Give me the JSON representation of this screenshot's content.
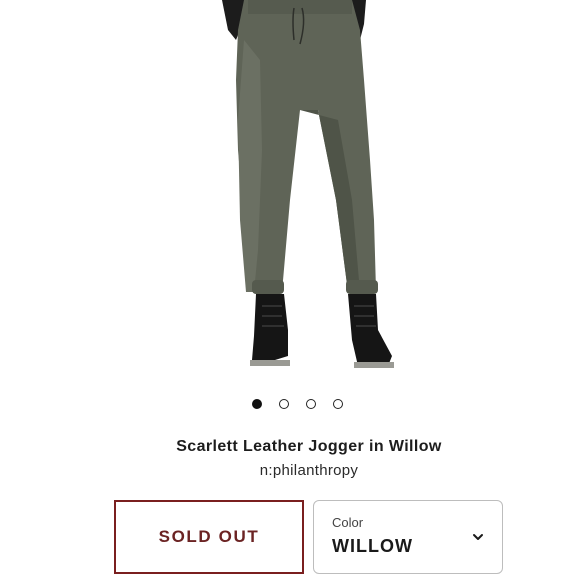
{
  "product": {
    "title": "Scarlett Leather Jogger in Willow",
    "brand": "n:philanthropy",
    "image_icon": "product-photo-jogger-pants",
    "carousel": {
      "total": 4,
      "active_index": 0
    }
  },
  "purchase": {
    "status_label": "SOLD OUT",
    "status_color": "#6b2323"
  },
  "color_select": {
    "caption": "Color",
    "value": "WILLOW",
    "icon": "chevron-down-icon"
  }
}
